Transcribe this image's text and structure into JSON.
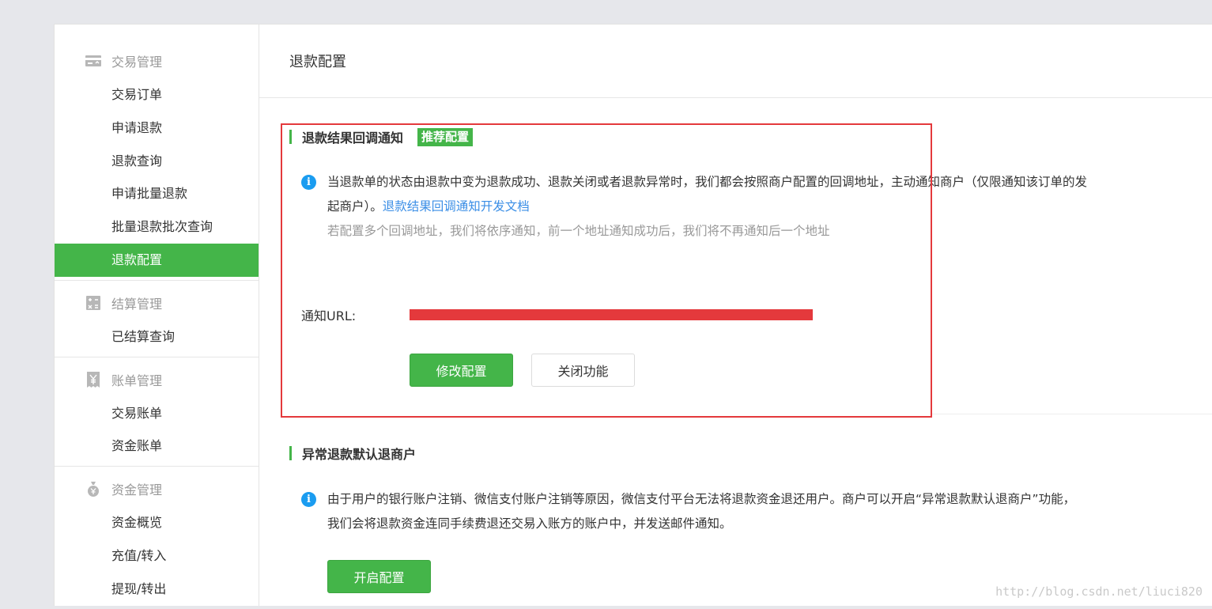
{
  "sidebar": {
    "groups": [
      {
        "title": "交易管理",
        "icon": "card-icon",
        "items": [
          "交易订单",
          "申请退款",
          "退款查询",
          "申请批量退款",
          "批量退款批次查询",
          "退款配置"
        ]
      },
      {
        "title": "结算管理",
        "icon": "calculator-icon",
        "items": [
          "已结算查询"
        ]
      },
      {
        "title": "账单管理",
        "icon": "yen-bill-icon",
        "items": [
          "交易账单",
          "资金账单"
        ]
      },
      {
        "title": "资金管理",
        "icon": "money-bag-icon",
        "items": [
          "资金概览",
          "充值/转入",
          "提现/转出"
        ]
      }
    ],
    "active_item": "退款配置"
  },
  "page": {
    "title": "退款配置"
  },
  "refund_notify": {
    "title": "退款结果回调通知",
    "badge": "推荐配置",
    "desc_line1": "当退款单的状态由退款中变为退款成功、退款关闭或者退款异常时，我们都会按照商户配置的回调地址，主动通知商户（仅限通知该订单的发",
    "desc_line2": "起商户）。",
    "doc_link": "退款结果回调通知开发文档",
    "note": "若配置多个回调地址，我们将依序通知，前一个地址通知成功后，我们将不再通知后一个地址",
    "url_label": "通知URL:",
    "modify_button": "修改配置",
    "close_button": "关闭功能"
  },
  "abnormal_refund": {
    "title": "异常退款默认退商户",
    "desc_line1": "由于用户的银行账户注销、微信支付账户注销等原因，微信支付平台无法将退款资金退还用户。商户可以开启“异常退款默认退商户”功能，",
    "desc_line2": "我们会将退款资金连同手续费退还交易入账方的账户中，并发送邮件通知。",
    "enable_button": "开启配置"
  },
  "watermark": "http://blog.csdn.net/liuci820",
  "colors": {
    "accent": "#44b549",
    "link": "#3a8ee6",
    "info": "#1a9cf0",
    "annotation": "#e4393c"
  }
}
